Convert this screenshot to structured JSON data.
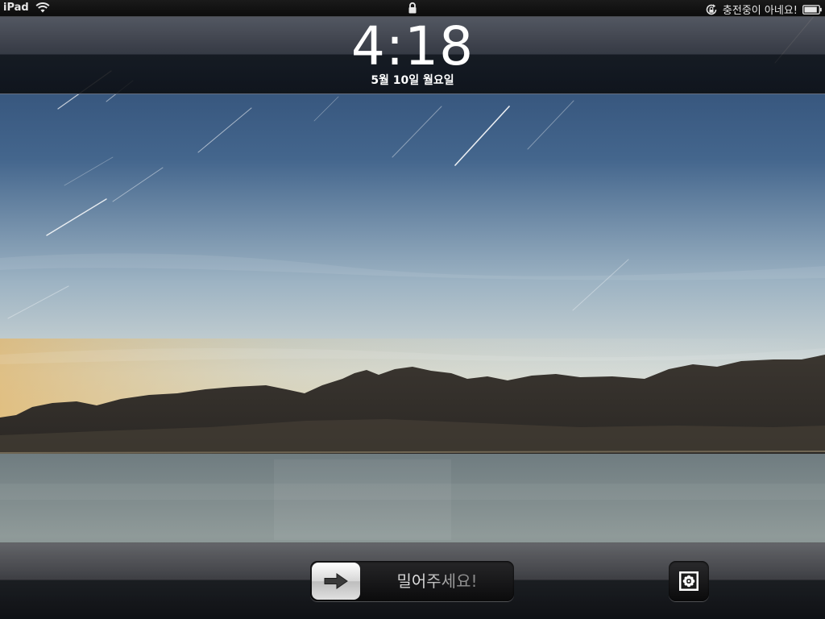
{
  "status_bar": {
    "device_name": "iPad",
    "wifi_icon": "wifi-icon",
    "lock_icon": "lock-icon",
    "orientation_lock_icon": "orientation-lock-icon",
    "charging_text": "충전중이 아네요!",
    "battery_icon": "battery-icon",
    "battery_level": 0.9
  },
  "lock_screen": {
    "time": "4:18",
    "date": "5월 10일 월요일"
  },
  "unlock_slider": {
    "label": "밀어주세요!",
    "arrow_icon": "arrow-right-icon"
  },
  "picture_frame_button": {
    "icon": "picture-frame-flower-icon"
  },
  "colors": {
    "status_text": "#e6e6e6",
    "clock_text": "#ffffff",
    "sky_top": "#2f4e73",
    "sky_horizon": "#c9d3d6",
    "water": "#7d8a8b"
  }
}
